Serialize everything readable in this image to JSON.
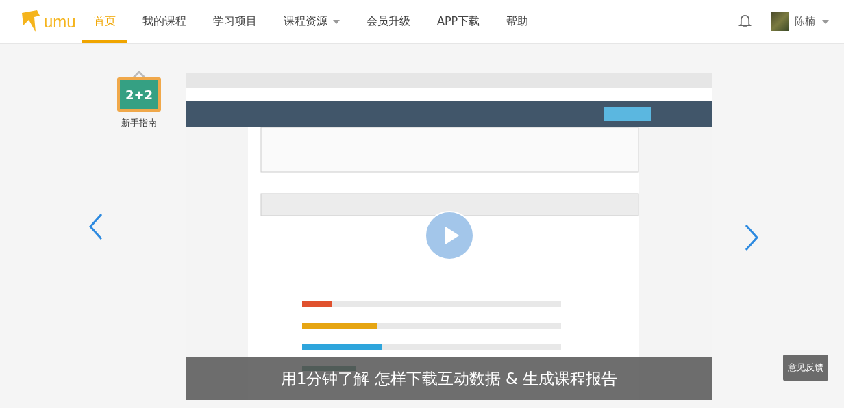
{
  "header": {
    "logo": "umu",
    "nav": [
      {
        "label": "首页",
        "selected": true,
        "has_menu": false
      },
      {
        "label": "我的课程",
        "selected": false,
        "has_menu": false
      },
      {
        "label": "学习项目",
        "selected": false,
        "has_menu": false
      },
      {
        "label": "课程资源",
        "selected": false,
        "has_menu": true
      },
      {
        "label": "会员升级",
        "selected": false,
        "has_menu": false
      },
      {
        "label": "APP下载",
        "selected": false,
        "has_menu": false
      },
      {
        "label": "帮助",
        "selected": false,
        "has_menu": false
      }
    ],
    "user": {
      "name": "陈楠"
    }
  },
  "guide": {
    "badge": "2+2",
    "label": "新手指南"
  },
  "video": {
    "caption": "用1分钟了解 怎样下载互动数据 & 生成课程报告"
  },
  "feedback_button": "意见反馈"
}
